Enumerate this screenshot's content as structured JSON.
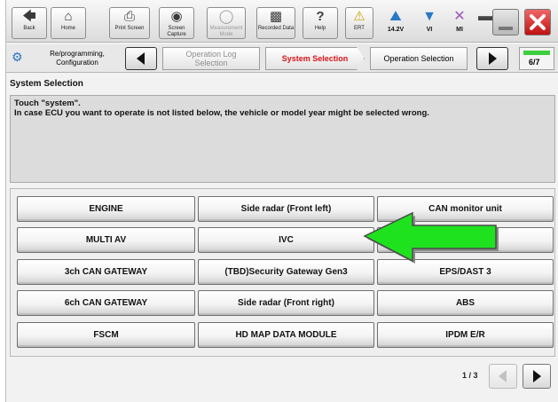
{
  "toolbar": {
    "back": "Back",
    "home": "Home",
    "print_screen": "Print Screen",
    "screen_capture": "Screen Capture",
    "measurement_mode": "Measurement Mode",
    "recorded_data": "Recorded Data",
    "help": "Help",
    "ert": "ERT"
  },
  "status": {
    "voltage": "14.2V",
    "vi": "VI",
    "mi": "MI"
  },
  "breadcrumb": {
    "step1": "Re/programming, Configuration",
    "step2": "Operation Log Selection",
    "step3": "System Selection",
    "step4": "Operation Selection",
    "page": "6/7"
  },
  "section_title": "System Selection",
  "instructions": {
    "line1": "Touch \"system\".",
    "line2": "In case ECU you want to operate is not listed below, the vehicle or model year might be selected wrong."
  },
  "systems": [
    "ENGINE",
    "Side radar (Front left)",
    "CAN monitor unit",
    "MULTI AV",
    "IVC",
    "",
    "3ch CAN GATEWAY",
    "(TBD)Security Gateway Gen3",
    "EPS/DAST 3",
    "6ch CAN GATEWAY",
    "Side radar (Front right)",
    "ABS",
    "FSCM",
    "HD MAP DATA MODULE",
    "IPDM E/R"
  ],
  "pager": {
    "label": "1 / 3"
  },
  "colors": {
    "accent_red": "#d7141a",
    "arrow_green": "#1fe21f",
    "arrow_outline": "#7a7a7a"
  }
}
